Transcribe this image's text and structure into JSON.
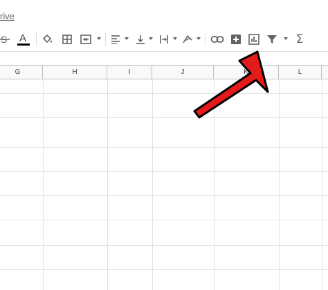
{
  "header": {
    "drive_link": "rive"
  },
  "toolbar": {
    "tools": [
      {
        "name": "strikethrough-icon"
      },
      {
        "name": "text-color-icon",
        "letter": "A",
        "underline_color": "#000000"
      },
      {
        "name": "fill-color-icon"
      },
      {
        "name": "borders-icon"
      },
      {
        "name": "merge-cells-icon"
      },
      {
        "name": "horizontal-align-icon"
      },
      {
        "name": "vertical-align-icon"
      },
      {
        "name": "text-wrapping-icon"
      },
      {
        "name": "text-rotation-icon"
      },
      {
        "name": "insert-link-icon"
      },
      {
        "name": "insert-comment-icon"
      },
      {
        "name": "insert-chart-icon"
      },
      {
        "name": "filter-icon"
      },
      {
        "name": "functions-icon",
        "glyph": "Σ"
      }
    ]
  },
  "columns": [
    "G",
    "H",
    "I",
    "J",
    "K",
    "L"
  ],
  "annotation": {
    "arrow_color": "#e41b1b",
    "outline_color": "#000000",
    "points_to": "filter-icon"
  }
}
